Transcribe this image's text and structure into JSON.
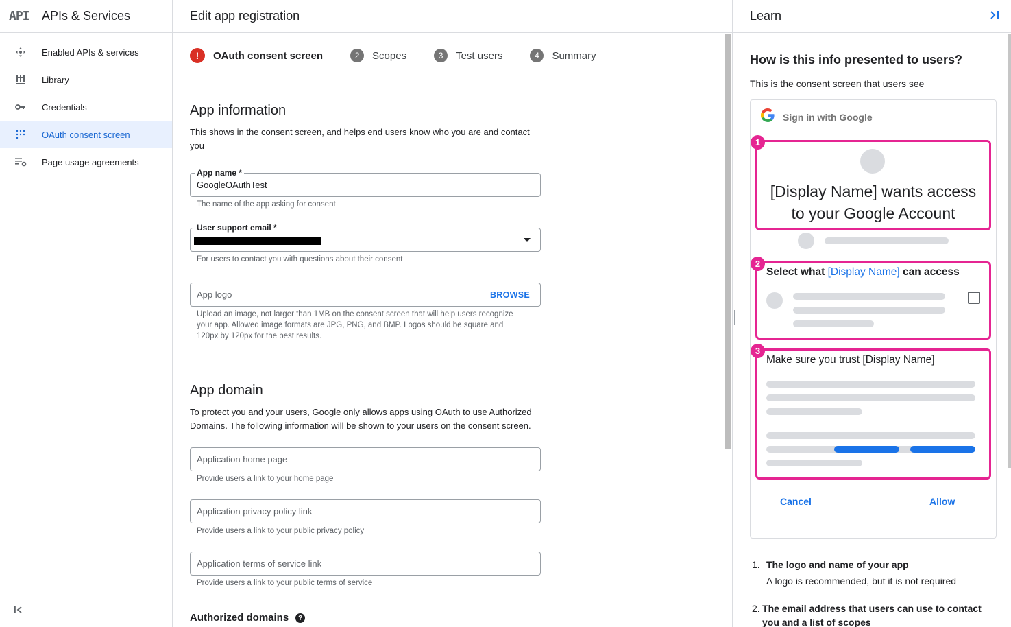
{
  "nav": {
    "logo": "API",
    "product": "APIs & Services",
    "items": [
      {
        "label": "Enabled APIs & services",
        "icon": "enabled-apis-icon",
        "active": false
      },
      {
        "label": "Library",
        "icon": "library-icon",
        "active": false
      },
      {
        "label": "Credentials",
        "icon": "key-icon",
        "active": false
      },
      {
        "label": "OAuth consent screen",
        "icon": "oauth-consent-icon",
        "active": true
      },
      {
        "label": "Page usage agreements",
        "icon": "settings-list-icon",
        "active": false
      }
    ],
    "collapse_icon": "collapse-nav-icon"
  },
  "main": {
    "title": "Edit app registration",
    "stepper": [
      {
        "num": "!",
        "label": "OAuth consent screen",
        "state": "error"
      },
      {
        "num": "2",
        "label": "Scopes",
        "state": "pending"
      },
      {
        "num": "3",
        "label": "Test users",
        "state": "pending"
      },
      {
        "num": "4",
        "label": "Summary",
        "state": "pending"
      }
    ],
    "app_info": {
      "title": "App information",
      "desc": "This shows in the consent screen, and helps end users know who you are and contact you",
      "app_name_label": "App name *",
      "app_name_value": "GoogleOAuthTest",
      "app_name_hint": "The name of the app asking for consent",
      "support_email_label": "User support email *",
      "support_email_hint": "For users to contact you with questions about their consent",
      "logo_placeholder": "App logo",
      "browse_label": "BROWSE",
      "logo_hint": "Upload an image, not larger than 1MB on the consent screen that will help users recognize your app. Allowed image formats are JPG, PNG, and BMP. Logos should be square and 120px by 120px for the best results."
    },
    "app_domain": {
      "title": "App domain",
      "desc": "To protect you and your users, Google only allows apps using OAuth to use Authorized Domains. The following information will be shown to your users on the consent screen.",
      "home_placeholder": "Application home page",
      "home_hint": "Provide users a link to your home page",
      "privacy_placeholder": "Application privacy policy link",
      "privacy_hint": "Provide users a link to your public privacy policy",
      "tos_placeholder": "Application terms of service link",
      "tos_hint": "Provide users a link to your public terms of service"
    },
    "authorized_domains_title": "Authorized domains",
    "help_icon": "help-icon"
  },
  "learn": {
    "title": "Learn",
    "heading": "How is this info presented to users?",
    "subheading": "This is the consent screen that users see",
    "mock": {
      "sign_in": "Sign in with Google",
      "box1_badge": "1",
      "box1_line1": "[Display Name] wants access",
      "box1_line2": "to your Google Account",
      "box2_badge": "2",
      "box2_prefix": "Select what ",
      "box2_name": "[Display Name]",
      "box2_suffix": " can access",
      "box3_badge": "3",
      "box3_text": "Make sure you trust [Display Name]",
      "cancel": "Cancel",
      "allow": "Allow"
    },
    "list": [
      {
        "num": "1.",
        "title": "The logo and name of your app",
        "desc": "A logo is recommended, but it is not required"
      },
      {
        "num": "2.",
        "title": "The email address that users can use to contact you and a list of scopes",
        "desc": ""
      }
    ],
    "colors": {
      "accent": "#1a73e8",
      "highlight": "#e52592",
      "error": "#d93025"
    }
  }
}
